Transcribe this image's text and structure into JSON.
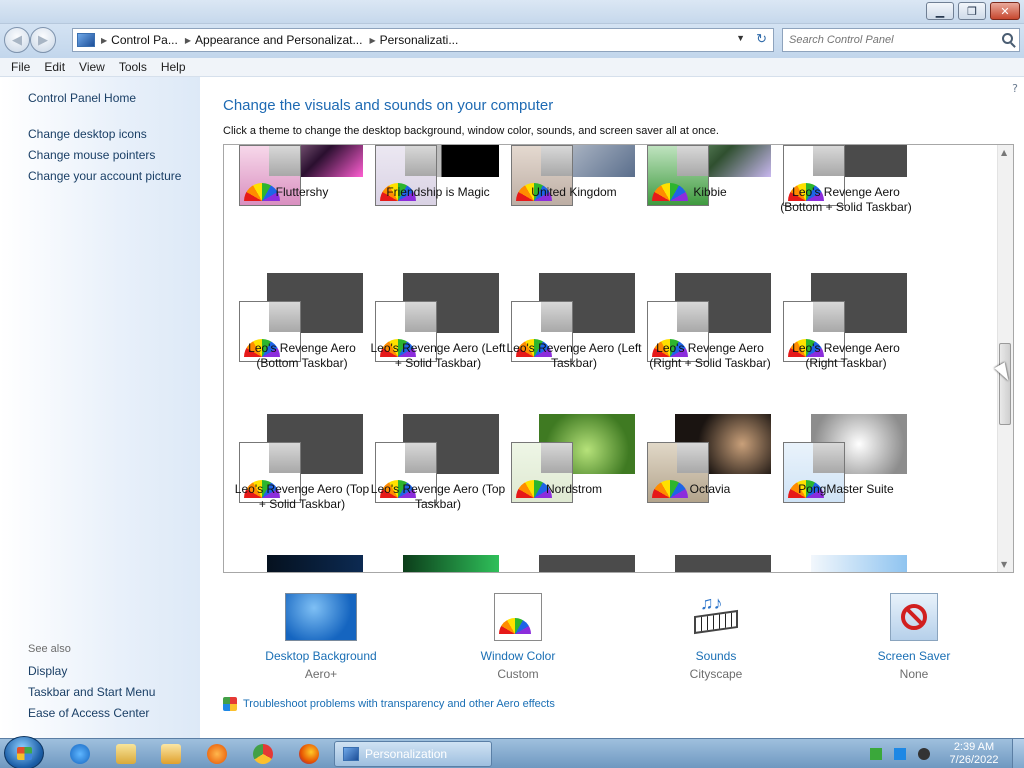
{
  "window": {
    "minimize_icon": "minimize-icon",
    "maximize_icon": "maximize-icon",
    "close_icon": "close-icon"
  },
  "address": {
    "crumbs": [
      "Control Pa...",
      "Appearance and Personalizat...",
      "Personalizati..."
    ]
  },
  "search": {
    "placeholder": "Search Control Panel"
  },
  "menu": [
    "File",
    "Edit",
    "View",
    "Tools",
    "Help"
  ],
  "sidebar": {
    "home": "Control Panel Home",
    "links": [
      "Change desktop icons",
      "Change mouse pointers",
      "Change your account picture"
    ],
    "see_also_label": "See also",
    "see_also": [
      "Display",
      "Taskbar and Start Menu",
      "Ease of Access Center"
    ]
  },
  "main": {
    "title": "Change the visuals and sounds on your computer",
    "description": "Click a theme to change the desktop background, window color, sounds, and screen saver all at once.",
    "themes": [
      [
        "Fluttershy",
        "Friendship is Magic",
        "United Kingdom",
        "Kibbie",
        "Leo's Revenge Aero (Bottom + Solid Taskbar)"
      ],
      [
        "Leo's Revenge Aero (Bottom Taskbar)",
        "Leo's Revenge Aero (Left + Solid Taskbar)",
        "Leo's Revenge Aero (Left Taskbar)",
        "Leo's Revenge Aero (Right + Solid Taskbar)",
        "Leo's Revenge Aero (Right Taskbar)"
      ],
      [
        "Leo's Revenge Aero (Top + Solid Taskbar)",
        "Leo's Revenge Aero (Top Taskbar)",
        "Nordstrom",
        "Octavia",
        "PongMaster Suite"
      ]
    ]
  },
  "settings": [
    {
      "label": "Desktop Background",
      "value": "Aero+"
    },
    {
      "label": "Window Color",
      "value": "Custom"
    },
    {
      "label": "Sounds",
      "value": "Cityscape"
    },
    {
      "label": "Screen Saver",
      "value": "None"
    }
  ],
  "troubleshoot": "Troubleshoot problems with transparency and other Aero effects",
  "taskbar": {
    "active_window": "Personalization",
    "time": "2:39 AM",
    "date": "7/26/2022"
  }
}
